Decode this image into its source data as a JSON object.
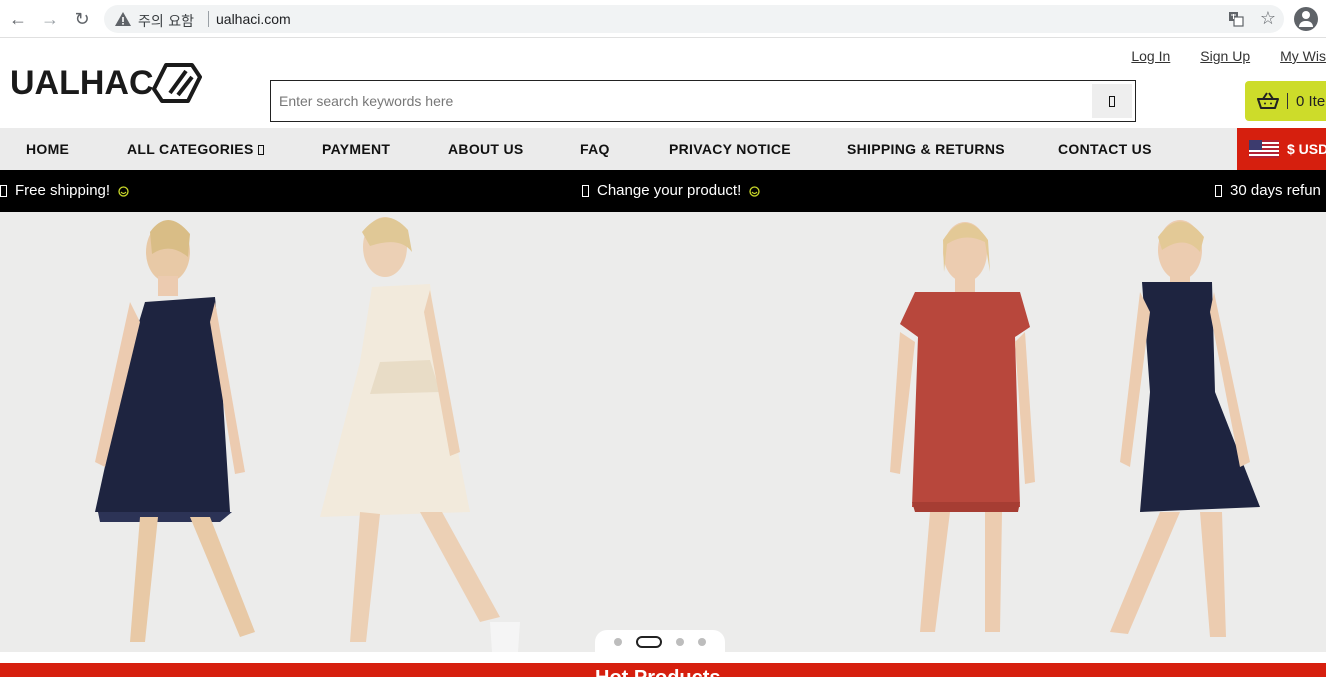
{
  "browser": {
    "warning_text": "주의 요함",
    "url": "ualhaci.com"
  },
  "header": {
    "logo_text": "UALHAC",
    "links": [
      "Log In",
      "Sign Up",
      "My Wis"
    ],
    "search_placeholder": "Enter search keywords here",
    "cart_label": "0 Ite"
  },
  "nav": {
    "items": [
      "HOME",
      "ALL CATEGORIES",
      "PAYMENT",
      "ABOUT US",
      "FAQ",
      "PRIVACY NOTICE",
      "SHIPPING & RETURNS",
      "CONTACT US"
    ],
    "currency": "$ USD"
  },
  "ticker": {
    "items": [
      "Free shipping!",
      "Change your product!",
      "30 days refun"
    ]
  },
  "slider": {
    "active_index": 1,
    "count": 4
  },
  "section": {
    "title": "Hot Products"
  },
  "colors": {
    "accent_red": "#d61f0e",
    "cart_yellow": "#cddc2a",
    "nav_bg": "#ebebeb",
    "ticker_bg": "#000000"
  }
}
